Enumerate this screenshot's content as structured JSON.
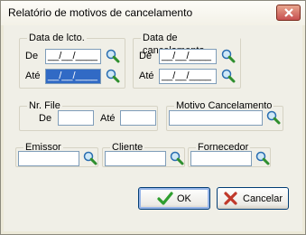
{
  "window": {
    "title": "Relatório de motivos de cancelamento"
  },
  "group_data_lcto": {
    "legend": "Data de lcto.",
    "de_label": "De",
    "ate_label": "Até",
    "de_value": "__/__/____",
    "ate_value": "__/__/____"
  },
  "group_data_cancel": {
    "legend": "Data de cancelamento",
    "de_label": "De",
    "ate_label": "Até",
    "de_value": "__/__/____",
    "ate_value": "__/__/____"
  },
  "group_nr_file": {
    "legend": "Nr. File",
    "de_label": "De",
    "ate_label": "Até",
    "de_value": "",
    "ate_value": ""
  },
  "group_motivo": {
    "legend": "Motivo Cancelamento",
    "value": ""
  },
  "group_emissor": {
    "legend": "Emissor",
    "value": ""
  },
  "group_cliente": {
    "legend": "Cliente",
    "value": ""
  },
  "group_fornecedor": {
    "legend": "Fornecedor",
    "value": ""
  },
  "buttons": {
    "ok_label": "OK",
    "cancel_label": "Cancelar"
  },
  "icons": {
    "lookup": "magnifier-icon",
    "ok": "check-icon",
    "cancel": "x-icon",
    "close": "close-icon"
  },
  "colors": {
    "accent": "#316ac5",
    "close_button": "#c75050",
    "ok_check": "#2e9e2e",
    "cancel_x": "#c0392b"
  }
}
